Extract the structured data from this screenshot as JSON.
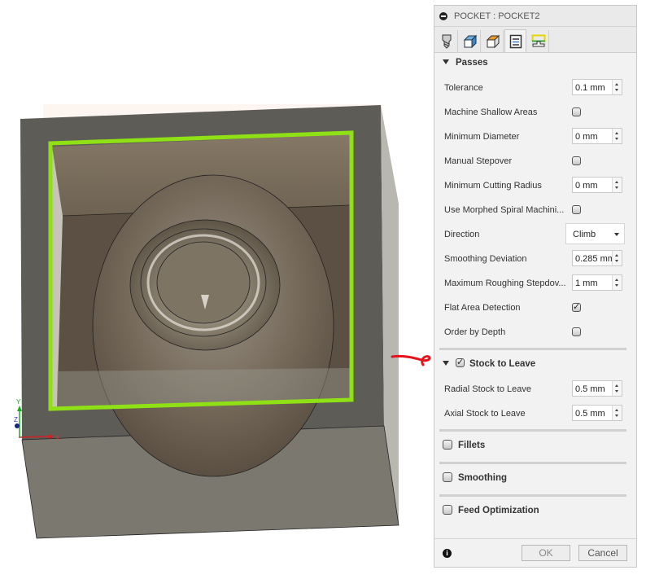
{
  "panel": {
    "title": "POCKET : POCKET2",
    "tabs": [
      {
        "name": "tool",
        "icon": "drill-bit-icon"
      },
      {
        "name": "geometry",
        "icon": "blue-box-icon"
      },
      {
        "name": "heights",
        "icon": "orange-top-box-icon"
      },
      {
        "name": "passes",
        "icon": "passes-icon",
        "active": true
      },
      {
        "name": "linking",
        "icon": "linking-icon"
      }
    ],
    "passes": {
      "header": "Passes",
      "tolerance": {
        "label": "Tolerance",
        "value": "0.1 mm"
      },
      "machine_shallow": {
        "label": "Machine Shallow Areas",
        "checked": false
      },
      "min_diameter": {
        "label": "Minimum Diameter",
        "value": "0 mm"
      },
      "manual_stepover": {
        "label": "Manual Stepover",
        "checked": false
      },
      "min_cutting_radius": {
        "label": "Minimum Cutting Radius",
        "value": "0 mm"
      },
      "morphed_spiral": {
        "label": "Use Morphed Spiral Machini...",
        "checked": false
      },
      "direction": {
        "label": "Direction",
        "value": "Climb"
      },
      "smoothing_deviation": {
        "label": "Smoothing Deviation",
        "value": "0.285 mm"
      },
      "max_roughing_stepdown": {
        "label": "Maximum Roughing Stepdov...",
        "value": "1 mm"
      },
      "flat_area": {
        "label": "Flat Area Detection",
        "checked": true
      },
      "order_by_depth": {
        "label": "Order by Depth",
        "checked": false
      }
    },
    "stock": {
      "header": "Stock to Leave",
      "checked": true,
      "radial": {
        "label": "Radial Stock to Leave",
        "value": "0.5 mm"
      },
      "axial": {
        "label": "Axial Stock to Leave",
        "value": "0.5 mm"
      }
    },
    "fillets": {
      "label": "Fillets",
      "checked": false
    },
    "smoothing": {
      "label": "Smoothing",
      "checked": false
    },
    "feed_optimization": {
      "label": "Feed Optimization",
      "checked": false
    },
    "footer": {
      "ok_label": "OK",
      "cancel_label": "Cancel",
      "info_glyph": "i"
    }
  },
  "viewport": {
    "axes": {
      "x_label": "X",
      "y_label": "Y",
      "z_label": "Z"
    },
    "colors": {
      "selection": "#8fe014",
      "annotation": "#e8121a"
    }
  }
}
